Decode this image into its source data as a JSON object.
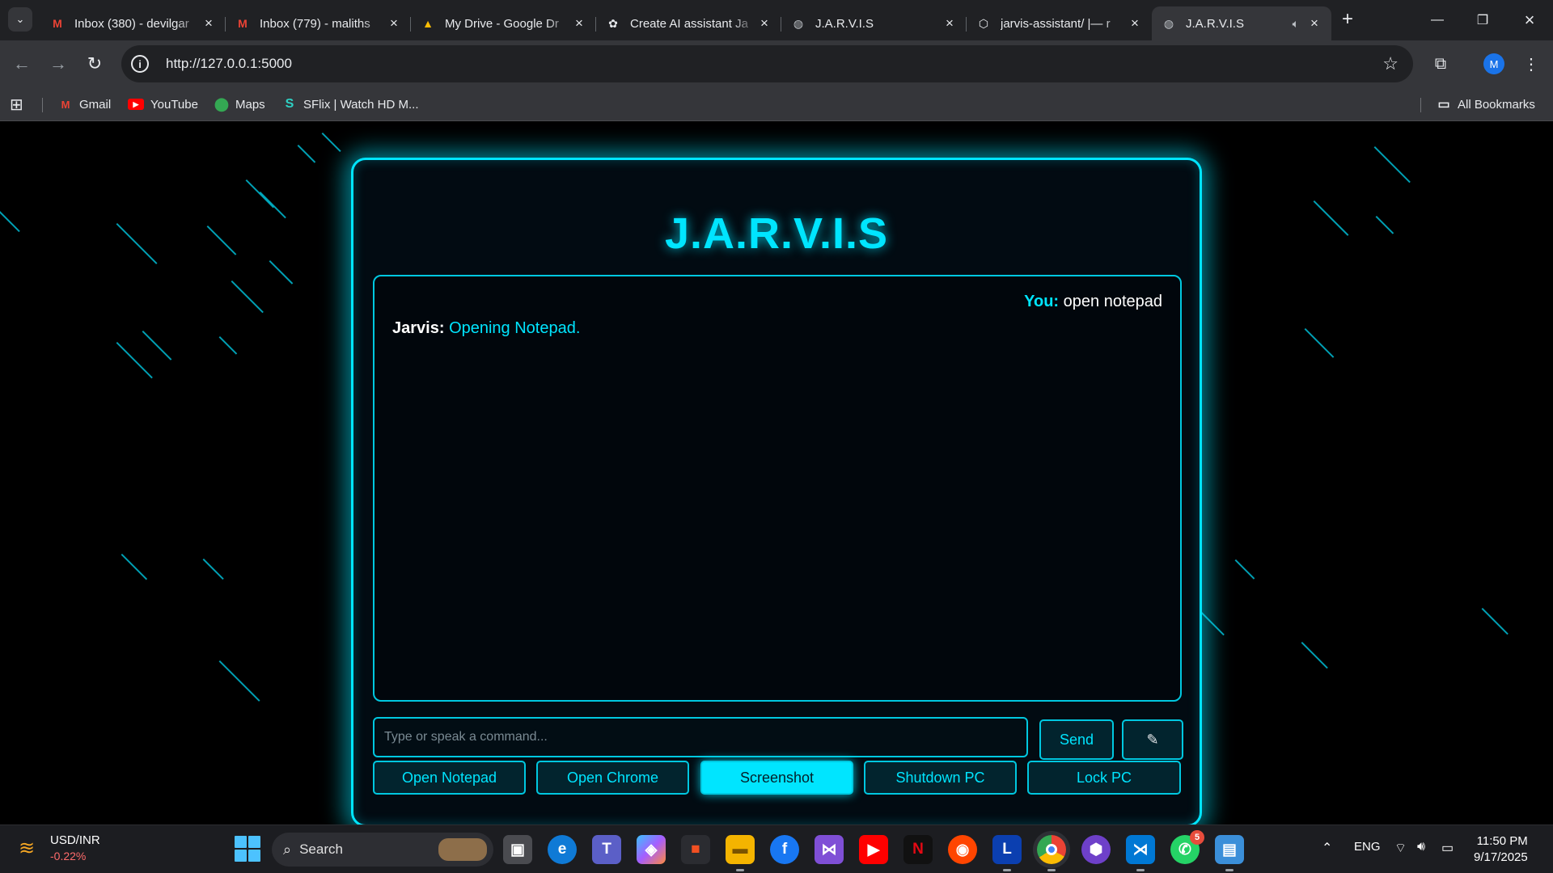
{
  "browser": {
    "tabs": [
      {
        "title": "Inbox (380) - devilgar",
        "favicon": "gmail-icon",
        "fav_glyph": "M",
        "fav_color": "#ea4335"
      },
      {
        "title": "Inbox (779) - maliths",
        "favicon": "gmail-icon",
        "fav_glyph": "M",
        "fav_color": "#ea4335"
      },
      {
        "title": "My Drive - Google Dr",
        "favicon": "google-drive-icon",
        "fav_glyph": "▲",
        "fav_color": "#fbbc04"
      },
      {
        "title": "Create AI assistant Ja",
        "favicon": "chatgpt-icon",
        "fav_glyph": "✿",
        "fav_color": "#e8eaed"
      },
      {
        "title": "J.A.R.V.I.S",
        "favicon": "globe-icon",
        "fav_glyph": "◍",
        "fav_color": "#bdc1c6"
      },
      {
        "title": "jarvis-assistant/ |— r",
        "favicon": "github-icon",
        "fav_glyph": "⬡",
        "fav_color": "#e8eaed"
      },
      {
        "title": "J.A.R.V.I.S",
        "favicon": "globe-icon",
        "fav_glyph": "◍",
        "fav_color": "#bdc1c6",
        "active": true,
        "audio": true
      }
    ],
    "url": "http://127.0.0.1:5000",
    "profile_initial": "M",
    "bookmarks": [
      {
        "label": "Gmail",
        "icon": "gmail-icon"
      },
      {
        "label": "YouTube",
        "icon": "youtube-icon"
      },
      {
        "label": "Maps",
        "icon": "maps-icon"
      },
      {
        "label": "SFlix | Watch HD M...",
        "icon": "sflix-icon"
      }
    ],
    "all_bookmarks": "All Bookmarks"
  },
  "jarvis": {
    "title": "J.A.R.V.I.S",
    "user_label": "You:",
    "user_message": "open notepad",
    "bot_label": "Jarvis:",
    "bot_message": "Opening Notepad.",
    "input_placeholder": "Type or speak a command...",
    "send_label": "Send",
    "mic_glyph": "✎",
    "quick_actions": [
      "Open Notepad",
      "Open Chrome",
      "Screenshot",
      "Shutdown PC",
      "Lock PC"
    ],
    "highlighted_action": "Screenshot"
  },
  "taskbar": {
    "ticker_symbol": "USD/INR",
    "ticker_change": "-0.22%",
    "search_label": "Search",
    "whatsapp_badge": "5",
    "language": "ENG",
    "time": "11:50 PM",
    "date": "9/17/2025"
  },
  "colors": {
    "accent": "#00e5ff",
    "background": "#000000"
  }
}
